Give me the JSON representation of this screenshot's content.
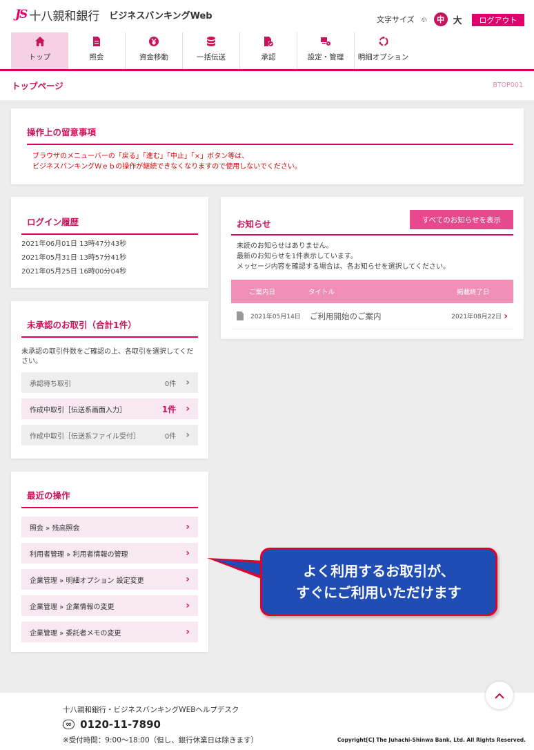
{
  "header": {
    "logo_mark": "JS",
    "bank_name": "十八親和銀行",
    "product_name": "ビジネスバンキングWeb",
    "font_size_label": "文字サイズ",
    "font_small": "小",
    "font_medium": "中",
    "font_large": "大",
    "logout": "ログアウト"
  },
  "nav": [
    {
      "label": "トップ",
      "icon": "home-icon",
      "active": true
    },
    {
      "label": "照会",
      "icon": "document-icon"
    },
    {
      "label": "資金移動",
      "icon": "yen-transfer-icon"
    },
    {
      "label": "一括伝送",
      "icon": "database-icon"
    },
    {
      "label": "承認",
      "icon": "approval-icon"
    },
    {
      "label": "設定・管理",
      "icon": "settings-management-icon"
    },
    {
      "label": "明細オプション",
      "icon": "cycle-icon"
    }
  ],
  "page": {
    "title": "トップページ",
    "code": "BTOP001"
  },
  "notice": {
    "title": "操作上の留意事項",
    "line1": "ブラウザのメニューバーの「戻る」「進む」「中止」「×」ボタン等は、",
    "line2": "ビジネスバンキングＷｅｂの操作が継続できなくなりますので使用しないでください。"
  },
  "login_history": {
    "title": "ログイン履歴",
    "entries": [
      "2021年06月01日 13時47分43秒",
      "2021年05月31日 13時57分41秒",
      "2021年05月25日 16時00分04秒"
    ]
  },
  "unapproved": {
    "title": "未承認のお取引（合計1件）",
    "desc": "未承認の取引件数をご確認の上、各取引を選択してください。",
    "rows": [
      {
        "label": "承認待ち取引",
        "count": "0件"
      },
      {
        "label": "作成中取引［伝送系画面入力］",
        "count": "1件"
      },
      {
        "label": "作成中取引［伝送系ファイル受付］",
        "count": "0件"
      }
    ]
  },
  "recent": {
    "title": "最近の操作",
    "items": [
      "照会 » 残高照会",
      "利用者管理 » 利用者情報の管理",
      "企業管理 » 明細オプション 設定変更",
      "企業管理 » 企業情報の変更",
      "企業管理 » 委託者メモの変更"
    ]
  },
  "info": {
    "title": "お知らせ",
    "all_button": "すべてのお知らせを表示",
    "line1": "未読のお知らせはありません。",
    "line2": "最新のお知らせを1件表示しています。",
    "line3": "メッセージ内容を確認する場合は、各お知らせを選択してください。",
    "columns": [
      "ご案内日",
      "タイトル",
      "掲載終了日"
    ],
    "row": {
      "date": "2021年05月14日",
      "title": "ご利用開始のご案内",
      "end": "2021年08月22日"
    }
  },
  "callout": {
    "line1": "よく利用するお取引が、",
    "line2": "すぐにご利用いただけます"
  },
  "footer": {
    "helpdesk": "十八親和銀行・ビジネスバンキングWEBヘルプデスク",
    "phone": "0120-11-7890",
    "hours": "※受付時間：9:00～18:00（但し、銀行休業日は除きます）",
    "copyright": "Copyright[C] The Juhachi-Shinwa Bank, Ltd. All Rights Reserved."
  },
  "colors": {
    "accent": "#e0005a",
    "brand_pink": "#c8145a",
    "callout_blue": "#1f4db3"
  }
}
